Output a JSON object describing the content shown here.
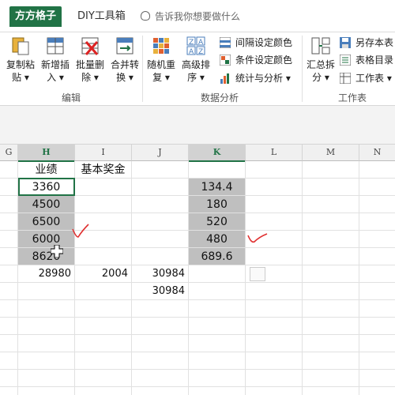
{
  "tabs": {
    "active": "方方格子",
    "diy": "DIY工具箱",
    "tell_me": "告诉我你想要做什么"
  },
  "ribbon": {
    "edit_group": {
      "label": "编辑",
      "copy": [
        "复制粘",
        "贴 ▾"
      ],
      "insert": [
        "新增插",
        "入 ▾"
      ],
      "delete": [
        "批量删",
        "除 ▾"
      ],
      "merge": [
        "合并转",
        "换 ▾"
      ]
    },
    "analysis_group": {
      "label": "数据分析",
      "random": [
        "随机重",
        "复 ▾"
      ],
      "sort": [
        "高级排",
        "序 ▾"
      ],
      "interval_color": "间隔设定颜色",
      "cond_color": "条件设定颜色",
      "stats": "统计与分析 ▾"
    },
    "sheet_group": {
      "label": "工作表",
      "summary": [
        "汇总拆",
        "分 ▾"
      ],
      "save_as": "另存本表",
      "toc": "表格目录",
      "sheet": "工作表 ▾"
    }
  },
  "columns": [
    "G",
    "H",
    "I",
    "J",
    "K",
    "L",
    "M",
    "N"
  ],
  "cells": {
    "h_header": "业绩",
    "i_header": "基本奖金",
    "h_values": [
      "3360",
      "4500",
      "6500",
      "6000",
      "8620"
    ],
    "k_values": [
      "134.4",
      "180",
      "520",
      "480",
      "689.6"
    ],
    "h_total": "28980",
    "i_total": "2004",
    "j_total": "30984",
    "j_total2": "30984"
  },
  "colors": {
    "accent": "#217346",
    "selection": "#bfbfbf",
    "annotation": "#e03030"
  }
}
